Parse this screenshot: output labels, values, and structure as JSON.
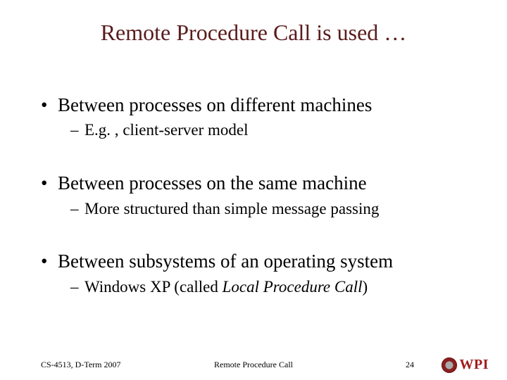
{
  "title": "Remote Procedure Call is used …",
  "groups": [
    {
      "main": "Between processes on different machines",
      "sub_prefix": "E.g. , ",
      "sub_plain": "client-server model",
      "sub_italic": ""
    },
    {
      "main": "Between processes on the same machine",
      "sub_prefix": "",
      "sub_plain": "More structured than simple message passing",
      "sub_italic": ""
    },
    {
      "main": "Between subsystems of an operating system",
      "sub_prefix": "Windows XP (called ",
      "sub_plain": "",
      "sub_italic": "Local Procedure Call",
      "sub_suffix": ")"
    }
  ],
  "footer": {
    "left": "CS-4513, D-Term 2007",
    "center": "Remote Procedure Call",
    "page": "24",
    "logo_text": "WPI"
  }
}
